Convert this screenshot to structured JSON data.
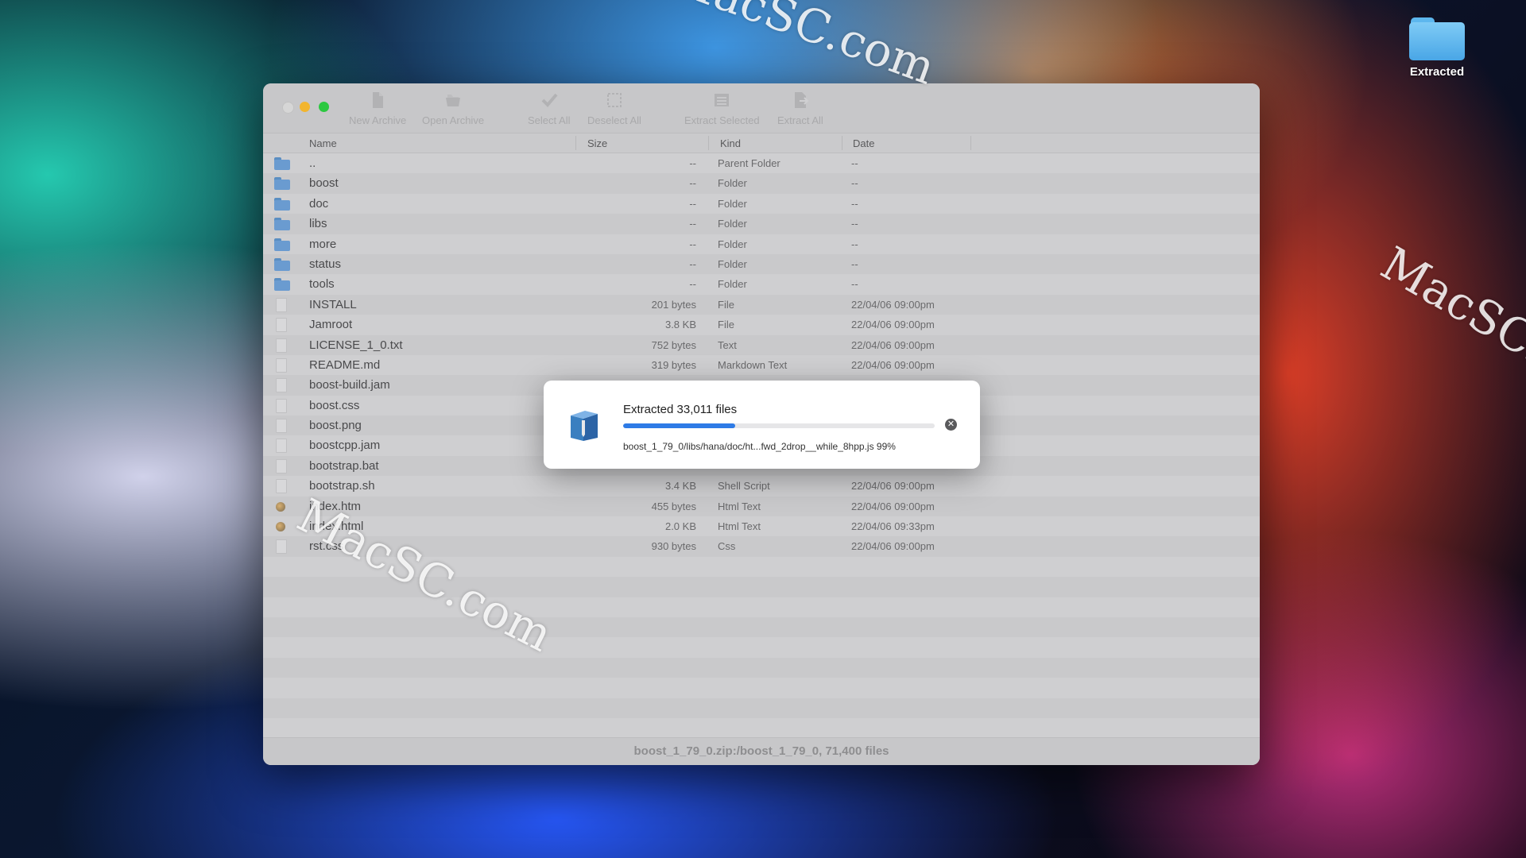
{
  "desktop": {
    "folder_label": "Extracted",
    "watermark": "MacSC.com"
  },
  "window": {
    "toolbar": {
      "new_archive": "New Archive",
      "open_archive": "Open Archive",
      "select_all": "Select All",
      "deselect_all": "Deselect All",
      "extract_selected": "Extract Selected",
      "extract_all": "Extract All"
    },
    "columns": {
      "name": "Name",
      "size": "Size",
      "kind": "Kind",
      "date": "Date"
    },
    "rows": [
      {
        "name": "..",
        "size": "--",
        "kind": "Parent Folder",
        "date": "--",
        "icon": "folder-icon"
      },
      {
        "name": "boost",
        "size": "--",
        "kind": "Folder",
        "date": "--",
        "icon": "folder-icon"
      },
      {
        "name": "doc",
        "size": "--",
        "kind": "Folder",
        "date": "--",
        "icon": "folder-icon"
      },
      {
        "name": "libs",
        "size": "--",
        "kind": "Folder",
        "date": "--",
        "icon": "folder-icon"
      },
      {
        "name": "more",
        "size": "--",
        "kind": "Folder",
        "date": "--",
        "icon": "folder-icon"
      },
      {
        "name": "status",
        "size": "--",
        "kind": "Folder",
        "date": "--",
        "icon": "folder-icon"
      },
      {
        "name": "tools",
        "size": "--",
        "kind": "Folder",
        "date": "--",
        "icon": "folder-icon"
      },
      {
        "name": "INSTALL",
        "size": "201 bytes",
        "kind": "File",
        "date": "22/04/06 09:00pm",
        "icon": "file-icon"
      },
      {
        "name": "Jamroot",
        "size": "3.8 KB",
        "kind": "File",
        "date": "22/04/06 09:00pm",
        "icon": "file-icon"
      },
      {
        "name": "LICENSE_1_0.txt",
        "size": "752 bytes",
        "kind": "Text",
        "date": "22/04/06 09:00pm",
        "icon": "file-icon"
      },
      {
        "name": "README.md",
        "size": "319 bytes",
        "kind": "Markdown Text",
        "date": "22/04/06 09:00pm",
        "icon": "file-icon"
      },
      {
        "name": "boost-build.jam",
        "size": "",
        "kind": "",
        "date": "",
        "icon": "file-icon"
      },
      {
        "name": "boost.css",
        "size": "",
        "kind": "",
        "date": "",
        "icon": "file-icon"
      },
      {
        "name": "boost.png",
        "size": "",
        "kind": "",
        "date": "",
        "icon": "file-icon"
      },
      {
        "name": "boostcpp.jam",
        "size": "",
        "kind": "",
        "date": "",
        "icon": "file-icon"
      },
      {
        "name": "bootstrap.bat",
        "size": "",
        "kind": "",
        "date": "",
        "icon": "file-icon"
      },
      {
        "name": "bootstrap.sh",
        "size": "3.4 KB",
        "kind": "Shell Script",
        "date": "22/04/06 09:00pm",
        "icon": "file-icon"
      },
      {
        "name": "index.htm",
        "size": "455 bytes",
        "kind": "Html Text",
        "date": "22/04/06 09:00pm",
        "icon": "web-icon"
      },
      {
        "name": "index.html",
        "size": "2.0 KB",
        "kind": "Html Text",
        "date": "22/04/06 09:33pm",
        "icon": "web-icon"
      },
      {
        "name": "rst.css",
        "size": "930 bytes",
        "kind": "Css",
        "date": "22/04/06 09:00pm",
        "icon": "file-icon"
      }
    ],
    "empty_rows": 9,
    "status": "boost_1_79_0.zip:/boost_1_79_0, 71,400 files"
  },
  "dialog": {
    "title": "Extracted 33,011 files",
    "progress": 0.36,
    "file": "boost_1_79_0/libs/hana/doc/ht...fwd_2drop__while_8hpp.js 99%"
  },
  "colors": {
    "accent": "#2e7be6",
    "folder": "#6a9bd0",
    "traffic_min": "#f2b52e",
    "traffic_max": "#2cc840"
  }
}
